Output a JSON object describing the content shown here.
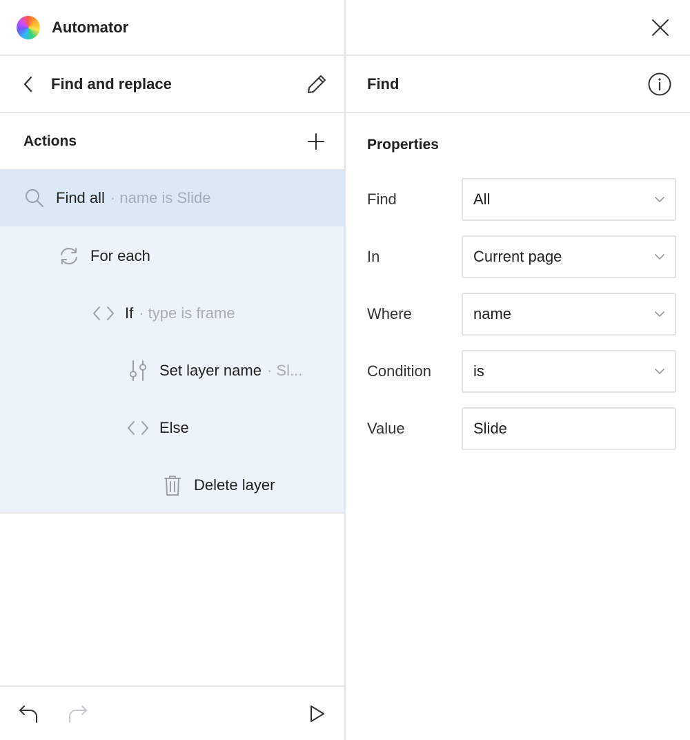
{
  "app": {
    "title": "Automator"
  },
  "workflow": {
    "title": "Find and replace"
  },
  "actions": {
    "title": "Actions",
    "items": [
      {
        "label": "Find all",
        "detail": "· name is Slide",
        "icon": "search-icon"
      },
      {
        "label": "For each",
        "detail": "",
        "icon": "loop-icon"
      },
      {
        "label": "If",
        "detail": "· type is frame",
        "icon": "code-icon"
      },
      {
        "label": "Set layer name",
        "detail": "· Sl...",
        "icon": "sliders-icon"
      },
      {
        "label": "Else",
        "detail": "",
        "icon": "code-icon"
      },
      {
        "label": "Delete layer",
        "detail": "",
        "icon": "trash-icon"
      }
    ]
  },
  "panel": {
    "title": "Find",
    "properties_title": "Properties",
    "properties": [
      {
        "label": "Find",
        "value": "All",
        "type": "select"
      },
      {
        "label": "In",
        "value": "Current page",
        "type": "select"
      },
      {
        "label": "Where",
        "value": "name",
        "type": "select"
      },
      {
        "label": "Condition",
        "value": "is",
        "type": "select"
      },
      {
        "label": "Value",
        "value": "Slide",
        "type": "input"
      }
    ]
  },
  "colors": {
    "selected_row": "#dbe9f6",
    "tree_background": "#edf3fa",
    "muted_text": "#a8adb3",
    "divider": "#e6e6e6"
  }
}
